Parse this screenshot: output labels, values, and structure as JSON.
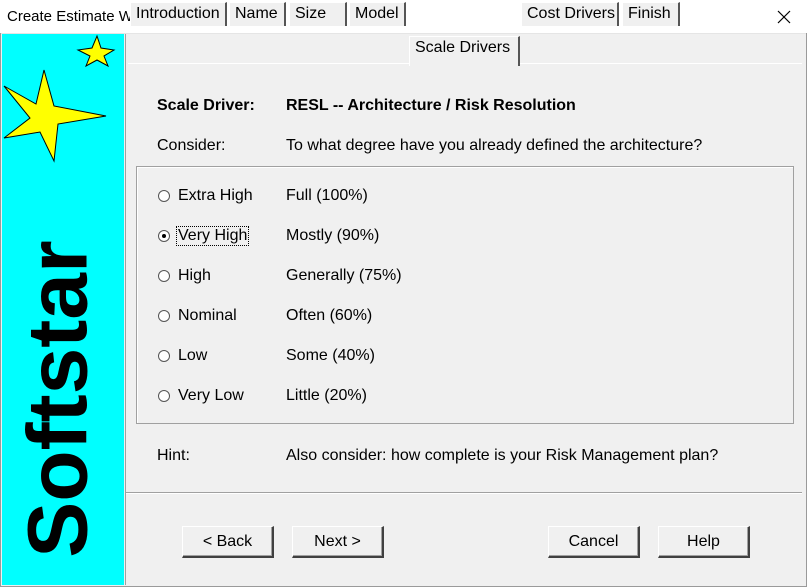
{
  "window": {
    "title": "Create Estimate Wizard"
  },
  "sidebar": {
    "brand": "Softstar",
    "background": "#00ffff",
    "star_color": "#ffff00"
  },
  "tabs": [
    {
      "label": "Introduction"
    },
    {
      "label": "Name"
    },
    {
      "label": "Size"
    },
    {
      "label": "Model"
    },
    {
      "label": "Scale Drivers",
      "active": true
    },
    {
      "label": "Cost Drivers"
    },
    {
      "label": "Finish"
    }
  ],
  "scale_driver": {
    "label": "Scale Driver:",
    "value": "RESL -- Architecture / Risk Resolution"
  },
  "consider": {
    "label": "Consider:",
    "text": "To what degree have you already defined the architecture?"
  },
  "options": [
    {
      "rating": "Extra High",
      "description": "Full (100%)",
      "selected": false
    },
    {
      "rating": "Very High",
      "description": "Mostly (90%)",
      "selected": true
    },
    {
      "rating": "High",
      "description": "Generally (75%)",
      "selected": false
    },
    {
      "rating": "Nominal",
      "description": "Often (60%)",
      "selected": false
    },
    {
      "rating": "Low",
      "description": "Some (40%)",
      "selected": false
    },
    {
      "rating": "Very Low",
      "description": "Little (20%)",
      "selected": false
    }
  ],
  "hint": {
    "label": "Hint:",
    "text": "Also consider: how complete is your Risk Management plan?"
  },
  "buttons": {
    "back": "< Back",
    "next": "Next >",
    "cancel": "Cancel",
    "help": "Help"
  }
}
